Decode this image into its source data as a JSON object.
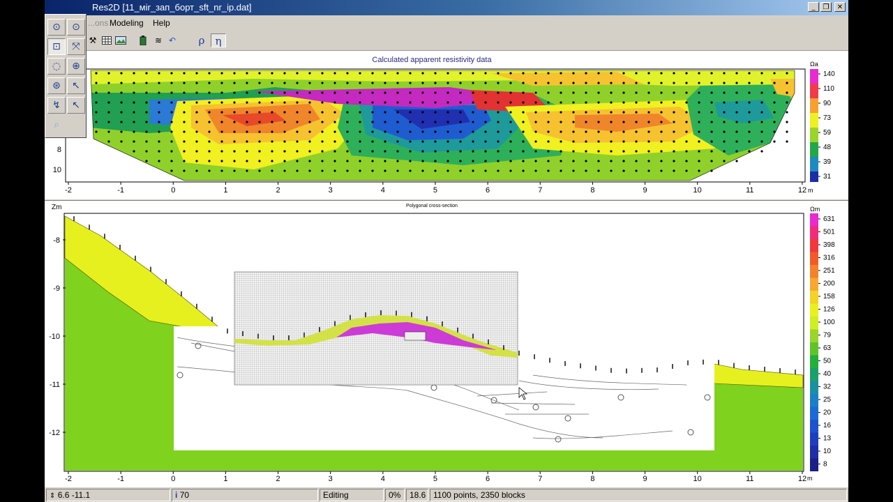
{
  "window": {
    "title": "Res2D [11_мir_зап_борт_sft_nr_ip.dat]",
    "minimize_glyph": "_",
    "restore_glyph": "❐",
    "close_glyph": "✕"
  },
  "menu": {
    "items": [
      "...ons",
      "Modeling",
      "Help"
    ]
  },
  "toolbar": {
    "rho_label": "ρ",
    "eta_label": "η"
  },
  "palette": {
    "icons": [
      "select-point-icon",
      "select-area-icon",
      "add-node-icon",
      "split-node-icon",
      "circle-select-icon",
      "move-node-icon",
      "rotate-icon",
      "cursor-join-icon",
      "edit-polygon-icon",
      "cursor-split-icon",
      "zoom-icon"
    ]
  },
  "top_chart": {
    "title": "Calculated apparent resistivity data",
    "y_ticks": [
      "8",
      "10"
    ],
    "x_ticks": [
      "-2",
      "-1",
      "0",
      "1",
      "2",
      "3",
      "4",
      "5",
      "6",
      "7",
      "8",
      "9",
      "10",
      "11",
      "12"
    ],
    "x_unit": "m",
    "legend_unit": "Ωa",
    "legend_values": [
      "140",
      "110",
      "90",
      "73",
      "59",
      "48",
      "39",
      "31"
    ]
  },
  "bottom_chart": {
    "title": "Polygonal cross-section",
    "y_axis_label": "Zm",
    "y_ticks": [
      "-8",
      "-9",
      "-10",
      "-11",
      "-12"
    ],
    "x_ticks": [
      "-2",
      "-1",
      "0",
      "1",
      "2",
      "3",
      "4",
      "5",
      "6",
      "7",
      "8",
      "9",
      "10",
      "11",
      "12"
    ],
    "x_unit": "m",
    "legend_unit": "Ωm",
    "legend_values": [
      "631",
      "501",
      "398",
      "316",
      "251",
      "200",
      "158",
      "126",
      "100",
      "79",
      "63",
      "50",
      "40",
      "32",
      "25",
      "20",
      "16",
      "13",
      "10",
      "8"
    ]
  },
  "status": {
    "coords": "6.6 -11.1",
    "value": "70",
    "mode": "Editing",
    "percent": "0%",
    "zoom": "18.6",
    "info": "1100 points,  2350 blocks"
  },
  "colors": {
    "yellow_layer": "#e6f01e",
    "green_layer": "#7fd21e",
    "magenta_block": "#cc3bd6",
    "title_bar": "#0a246a"
  }
}
